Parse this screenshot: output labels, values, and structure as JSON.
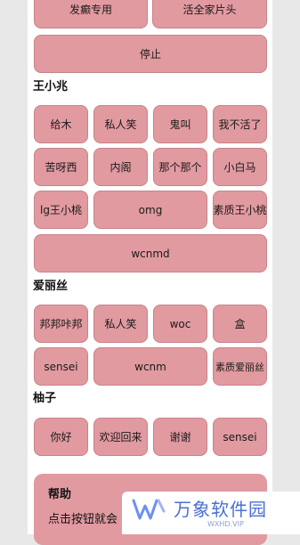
{
  "top": {
    "row1": [
      "发癫专用",
      "活全家片头"
    ],
    "stop": "停止"
  },
  "sections": [
    {
      "title": "王小兆",
      "buttons": [
        "给木",
        "私人笑",
        "鬼叫",
        "我不活了",
        "苦呀西",
        "内阁",
        "那个那个",
        "小白马",
        "lg王小桃",
        "omg",
        "素质王小桃",
        "wcnmd"
      ]
    },
    {
      "title": "爱丽丝",
      "buttons": [
        "邦邦咔邦",
        "私人笑",
        "woc",
        "盒",
        "sensei",
        "wcnm",
        "素质爱丽丝"
      ]
    },
    {
      "title": "柚子",
      "buttons": [
        "你好",
        "欢迎回来",
        "谢谢",
        "sensei"
      ]
    }
  ],
  "help": {
    "title": "帮助",
    "text": "点击按钮就会"
  },
  "watermark": {
    "brand": "万象软件园",
    "sub": "WXHD.VIP",
    "color": "#4a6fd6"
  },
  "colors": {
    "button": "#e19aa0",
    "panel": "#ffffff",
    "background": "#e8e8e8"
  }
}
